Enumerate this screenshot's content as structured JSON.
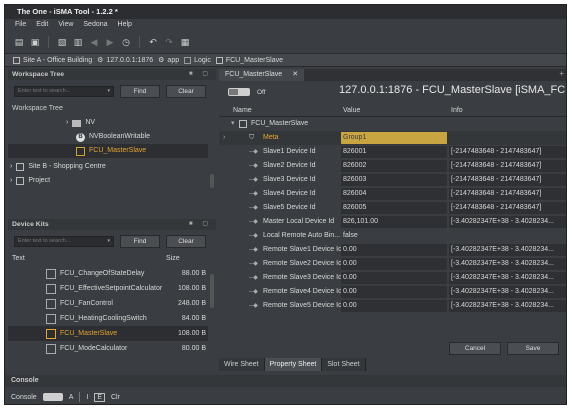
{
  "app": {
    "title": "The One - iSMA Tool - 1.2.2 *"
  },
  "menu": [
    "File",
    "Edit",
    "View",
    "Sedona",
    "Help"
  ],
  "breadcrumb": [
    {
      "label": "Site A - Office Building"
    },
    {
      "label": "127.0.0.1:1876"
    },
    {
      "label": "app"
    },
    {
      "label": "Logic"
    },
    {
      "label": "FCU_MasterSlave"
    }
  ],
  "workspace": {
    "panel_title": "Workspace Tree",
    "search_placeholder": "Enter text to search...",
    "find_label": "Find",
    "clear_label": "Clear",
    "tree_header": "Workspace Tree",
    "items": [
      {
        "label": "NV",
        "icon": "folder-icon"
      },
      {
        "label": "NVBooleanWritable",
        "icon": "b-icon"
      },
      {
        "label": "FCU_MasterSlave",
        "icon": "component-icon",
        "color": "#e6a530"
      },
      {
        "label": "Site B - Shopping Centre",
        "icon": "folder-icon"
      },
      {
        "label": "Project",
        "icon": "folder-icon"
      }
    ],
    "b_glyph": "B"
  },
  "device_kits": {
    "panel_title": "Device Kits",
    "search_placeholder": "Enter text to search...",
    "find_label": "Find",
    "clear_label": "Clear",
    "col_text": "Text",
    "col_size": "Size",
    "items": [
      {
        "label": "FCU_ChangeOfStateDelay",
        "size": "88.00 B"
      },
      {
        "label": "FCU_EffectiveSetpointCalculator",
        "size": "108.00 B"
      },
      {
        "label": "FCU_FanControl",
        "size": "248.00 B"
      },
      {
        "label": "FCU_HeatingCoolingSwitch",
        "size": "84.00 B"
      },
      {
        "label": "FCU_MasterSlave",
        "size": "108.00 B",
        "selected": true,
        "color": "#e6a530"
      },
      {
        "label": "FCU_ModeCalculator",
        "size": "80.00 B"
      }
    ]
  },
  "editor": {
    "tab_label": "FCU_MasterSlave",
    "tab_close": "✕",
    "toggle_label": "Off",
    "title": "127.0.0.1:1876 - FCU_MasterSlave [iSMA_FCU",
    "columns": {
      "name": "Name",
      "value": "Value",
      "info": "Info"
    },
    "root_label": "FCU_MasterSlave",
    "rows": [
      {
        "name": "Meta",
        "value": "Group1",
        "info": "",
        "highlight": true
      },
      {
        "name": "Slave1 Device Id",
        "value": "826001",
        "info": "[-2147483648 - 2147483647]"
      },
      {
        "name": "Slave2 Device Id",
        "value": "826002",
        "info": "[-2147483648 - 2147483647]"
      },
      {
        "name": "Slave3 Device Id",
        "value": "826003",
        "info": "[-2147483648 - 2147483647]"
      },
      {
        "name": "Slave4 Device Id",
        "value": "826004",
        "info": "[-2147483648 - 2147483647]"
      },
      {
        "name": "Slave5 Device Id",
        "value": "826005",
        "info": "[-2147483648 - 2147483647]"
      },
      {
        "name": "Master Local Device Id",
        "value": "826,101.00",
        "info": "[-3.40282347E+38 - 3.4028234..."
      },
      {
        "name": "Local Remote Auto Bin...",
        "value": "false",
        "info": ""
      },
      {
        "name": "Remote Slave1 Device Id",
        "value": "0.00",
        "info": "[-3.40282347E+38 - 3.4028234..."
      },
      {
        "name": "Remote Slave2 Device Id",
        "value": "0.00",
        "info": "[-3.40282347E+38 - 3.4028234..."
      },
      {
        "name": "Remote Slave3 Device Id",
        "value": "0.00",
        "info": "[-3.40282347E+38 - 3.4028234..."
      },
      {
        "name": "Remote Slave4 Device Id",
        "value": "0.00",
        "info": "[-3.40282347E+38 - 3.4028234..."
      },
      {
        "name": "Remote Slave5 Device Id",
        "value": "0.00",
        "info": "[-3.40282347E+38 - 3.4028234..."
      }
    ],
    "cancel_label": "Cancel",
    "save_label": "Save",
    "bottom_tabs": [
      "Wire Sheet",
      "Property Sheet",
      "Slot Sheet"
    ],
    "active_bottom_tab": 1
  },
  "console": {
    "panel_title": "Console",
    "label": "Console",
    "a_label": "A",
    "i_label": "I",
    "e_label": "E",
    "clr_label": "Clr"
  },
  "colors": {
    "accent": "#e6a530",
    "selected_bg": "#2c2e31",
    "highlight_value_bg": "#c9a542"
  }
}
